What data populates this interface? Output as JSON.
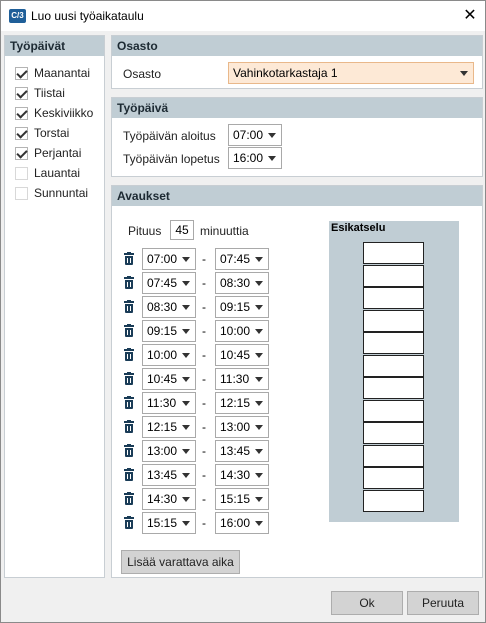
{
  "window": {
    "title": "Luo uusi työaikataulu",
    "icon_text": "C/3"
  },
  "workdays": {
    "header": "Työpäivät",
    "days": [
      {
        "label": "Maanantai",
        "checked": true
      },
      {
        "label": "Tiistai",
        "checked": true
      },
      {
        "label": "Keskiviikko",
        "checked": true
      },
      {
        "label": "Torstai",
        "checked": true
      },
      {
        "label": "Perjantai",
        "checked": true
      },
      {
        "label": "Lauantai",
        "checked": false
      },
      {
        "label": "Sunnuntai",
        "checked": false
      }
    ]
  },
  "osasto": {
    "header": "Osasto",
    "label": "Osasto",
    "value": "Vahinkotarkastaja 1"
  },
  "tyopaiva": {
    "header": "Työpäivä",
    "start_label": "Työpäivän aloitus",
    "start_value": "07:00",
    "end_label": "Työpäivän lopetus",
    "end_value": "16:00"
  },
  "avaukset": {
    "header": "Avaukset",
    "length_label": "Pituus",
    "length_value": "45",
    "length_unit": "minuuttia",
    "separator": "-",
    "slots": [
      {
        "start": "07:00",
        "end": "07:45"
      },
      {
        "start": "07:45",
        "end": "08:30"
      },
      {
        "start": "08:30",
        "end": "09:15"
      },
      {
        "start": "09:15",
        "end": "10:00"
      },
      {
        "start": "10:00",
        "end": "10:45"
      },
      {
        "start": "10:45",
        "end": "11:30"
      },
      {
        "start": "11:30",
        "end": "12:15"
      },
      {
        "start": "12:15",
        "end": "13:00"
      },
      {
        "start": "13:00",
        "end": "13:45"
      },
      {
        "start": "13:45",
        "end": "14:30"
      },
      {
        "start": "14:30",
        "end": "15:15"
      },
      {
        "start": "15:15",
        "end": "16:00"
      }
    ],
    "preview_title": "Esikatselu",
    "add_button": "Lisää varattava aika"
  },
  "footer": {
    "ok": "Ok",
    "cancel": "Peruuta"
  }
}
